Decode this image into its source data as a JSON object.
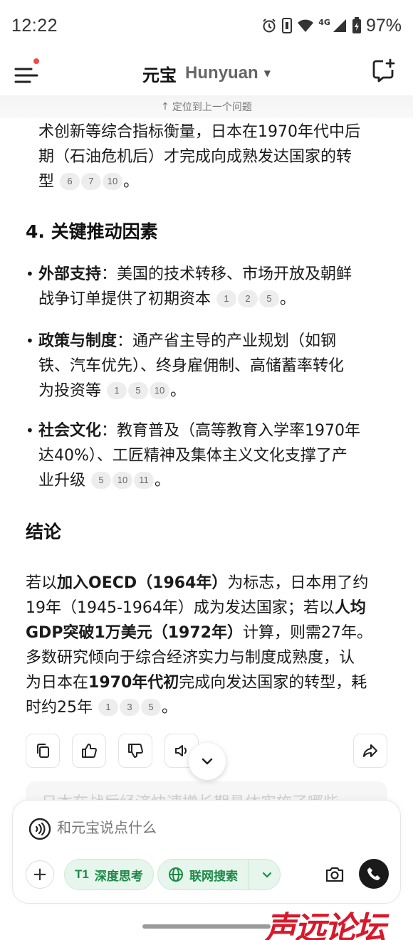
{
  "status_bar": {
    "time": "12:22",
    "network": "4G",
    "battery": "97%"
  },
  "header": {
    "title": "元宝",
    "model": "Hunyuan",
    "locate_previous": "定位到上一个问题"
  },
  "content": {
    "intro_line1": "术创新等综合指标衡量，日本在1970年代中后",
    "intro_line2": "期（石油危机后）才完成向成熟发达国家的转",
    "intro_line3": "型",
    "intro_cites": [
      "6",
      "7",
      "10"
    ],
    "section4_title": "4. 关键推动因素",
    "bullets": [
      {
        "label": "外部支持",
        "text_line1": "：美国的技术转移、市场开放及朝鲜",
        "text_line2": "战争订单提供了初期资本",
        "cites": [
          "1",
          "2",
          "5"
        ]
      },
      {
        "label": "政策与制度",
        "text_line1": "：通产省主导的产业规划（如钢",
        "text_line2": "铁、汽车优先）、终身雇佣制、高储蓄率转化",
        "text_line3": "为投资等",
        "cites": [
          "1",
          "5",
          "10"
        ]
      },
      {
        "label": "社会文化",
        "text_line1": "：教育普及（高等教育入学率1970年",
        "text_line2": "达40%）、工匠精神及集体主义文化支撑了产",
        "text_line3": "业升级",
        "cites": [
          "5",
          "10",
          "11"
        ]
      }
    ],
    "conclusion_title": "结论",
    "conclusion": {
      "l1_a": "若以",
      "l1_b": "加入OECD（1964年）",
      "l1_c": "为标志，日本用了约",
      "l2_a": "19年（1945-1964年）成为发达国家；若以",
      "l2_b": "人均",
      "l3_b": "GDP突破1万美元（1972年）",
      "l3_c": "计算，则需27年。",
      "l4": "多数研究倾向于综合经济实力与制度成熟度，认",
      "l5_a": "为日本在",
      "l5_b": "1970年代初",
      "l5_c": "完成向发达国家的转型，耗",
      "l6": "时约25年",
      "cites": [
        "1",
        "3",
        "5"
      ]
    }
  },
  "suggestion_faded": "日本在战后经济快速增长期具体实施了哪些",
  "input": {
    "placeholder": "和元宝说点什么",
    "deep_think_label": "深度思考",
    "deep_think_prefix": "T1",
    "web_search_label": "联网搜索"
  },
  "watermark": "声远论坛",
  "colors": {
    "accent_green": "#1c8a47",
    "pill_bg": "#e7f6ec",
    "notification_dot": "#f04a4a"
  }
}
